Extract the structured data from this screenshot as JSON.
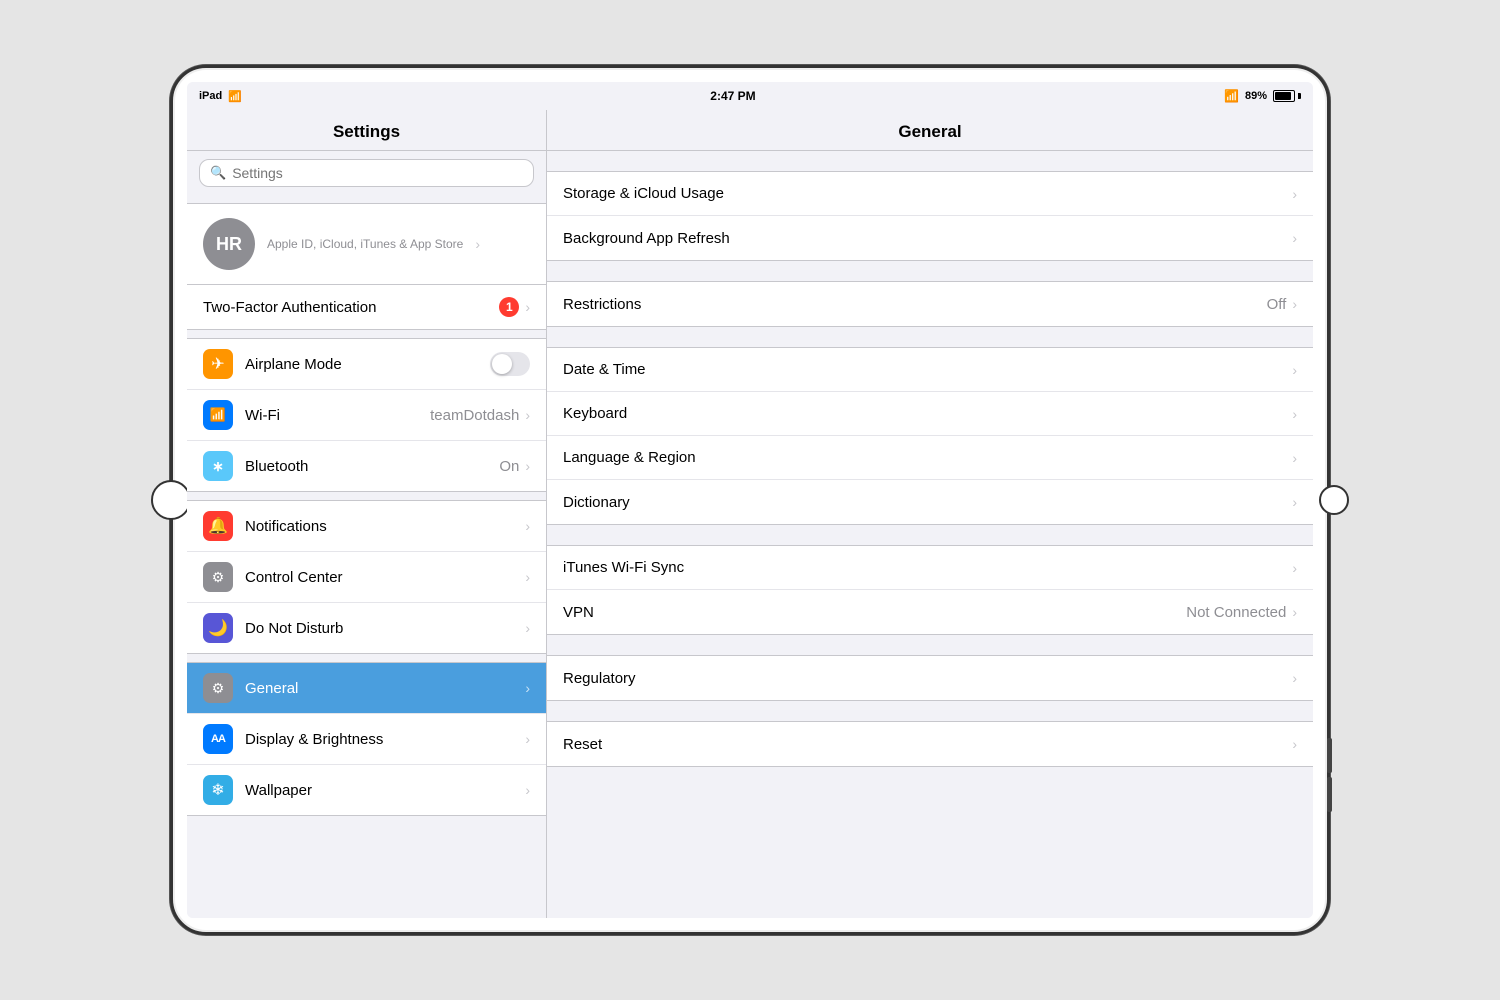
{
  "statusBar": {
    "left": "iPad",
    "wifiSymbol": "wifi",
    "time": "2:47 PM",
    "bluetoothSymbol": "B",
    "battery": "89%"
  },
  "leftPanel": {
    "title": "Settings",
    "search": {
      "placeholder": "Settings"
    },
    "user": {
      "initials": "HR",
      "subtitle": "Apple ID, iCloud, iTunes & App Store"
    },
    "twoFactor": {
      "label": "Two-Factor Authentication",
      "badge": "1"
    },
    "group1": [
      {
        "id": "airplane",
        "label": "Airplane Mode",
        "icon": "✈",
        "iconClass": "icon-orange",
        "control": "toggle",
        "value": "off"
      },
      {
        "id": "wifi",
        "label": "Wi-Fi",
        "icon": "📶",
        "iconClass": "icon-blue",
        "value": "teamDotdash"
      },
      {
        "id": "bluetooth",
        "label": "Bluetooth",
        "icon": "✱",
        "iconClass": "icon-blue2",
        "value": "On"
      }
    ],
    "group2": [
      {
        "id": "notifications",
        "label": "Notifications",
        "icon": "🔔",
        "iconClass": "icon-red"
      },
      {
        "id": "control-center",
        "label": "Control Center",
        "icon": "⚙",
        "iconClass": "icon-gray"
      },
      {
        "id": "do-not-disturb",
        "label": "Do Not Disturb",
        "icon": "🌙",
        "iconClass": "icon-purple"
      }
    ],
    "group3": [
      {
        "id": "general",
        "label": "General",
        "icon": "⚙",
        "iconClass": "icon-gray",
        "active": true
      },
      {
        "id": "display",
        "label": "Display & Brightness",
        "icon": "AA",
        "iconClass": "icon-blue-aa"
      },
      {
        "id": "wallpaper",
        "label": "Wallpaper",
        "icon": "❄",
        "iconClass": "icon-cyan"
      }
    ]
  },
  "rightPanel": {
    "title": "General",
    "group1": [
      {
        "id": "storage",
        "label": "Storage & iCloud Usage",
        "value": ""
      },
      {
        "id": "background",
        "label": "Background App Refresh",
        "value": ""
      }
    ],
    "group2": [
      {
        "id": "restrictions",
        "label": "Restrictions",
        "value": "Off"
      }
    ],
    "group3": [
      {
        "id": "datetime",
        "label": "Date & Time",
        "value": ""
      },
      {
        "id": "keyboard",
        "label": "Keyboard",
        "value": ""
      },
      {
        "id": "language",
        "label": "Language & Region",
        "value": ""
      },
      {
        "id": "dictionary",
        "label": "Dictionary",
        "value": ""
      }
    ],
    "group4": [
      {
        "id": "itunes",
        "label": "iTunes Wi-Fi Sync",
        "value": ""
      },
      {
        "id": "vpn",
        "label": "VPN",
        "value": "Not Connected"
      }
    ],
    "group5": [
      {
        "id": "regulatory",
        "label": "Regulatory",
        "value": ""
      }
    ],
    "group6": [
      {
        "id": "reset",
        "label": "Reset",
        "value": ""
      }
    ]
  }
}
